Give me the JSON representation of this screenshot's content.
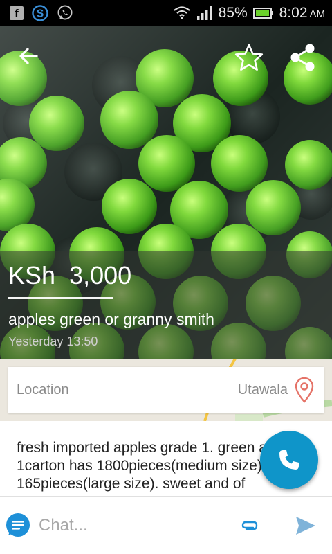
{
  "status_bar": {
    "battery": "85%",
    "time": "8:02",
    "ampm": "AM",
    "icons": [
      "facebook-icon",
      "skype-icon",
      "whatsapp-icon",
      "wifi-icon",
      "signal-icon",
      "battery-icon"
    ]
  },
  "listing": {
    "price": "KSh  3,000",
    "title": "apples green or granny smith",
    "posted": "Yesterday 13:50"
  },
  "location": {
    "label": "Location",
    "value": "Utawala"
  },
  "description": "fresh imported apples grade 1. green apples. 1carton has 1800pieces(medium size) 165pieces(large size). sweet and of",
  "chat": {
    "placeholder": "Chat..."
  },
  "colors": {
    "accent": "#0f95c9",
    "pin": "#e57368",
    "send": "#7fb3d9"
  }
}
